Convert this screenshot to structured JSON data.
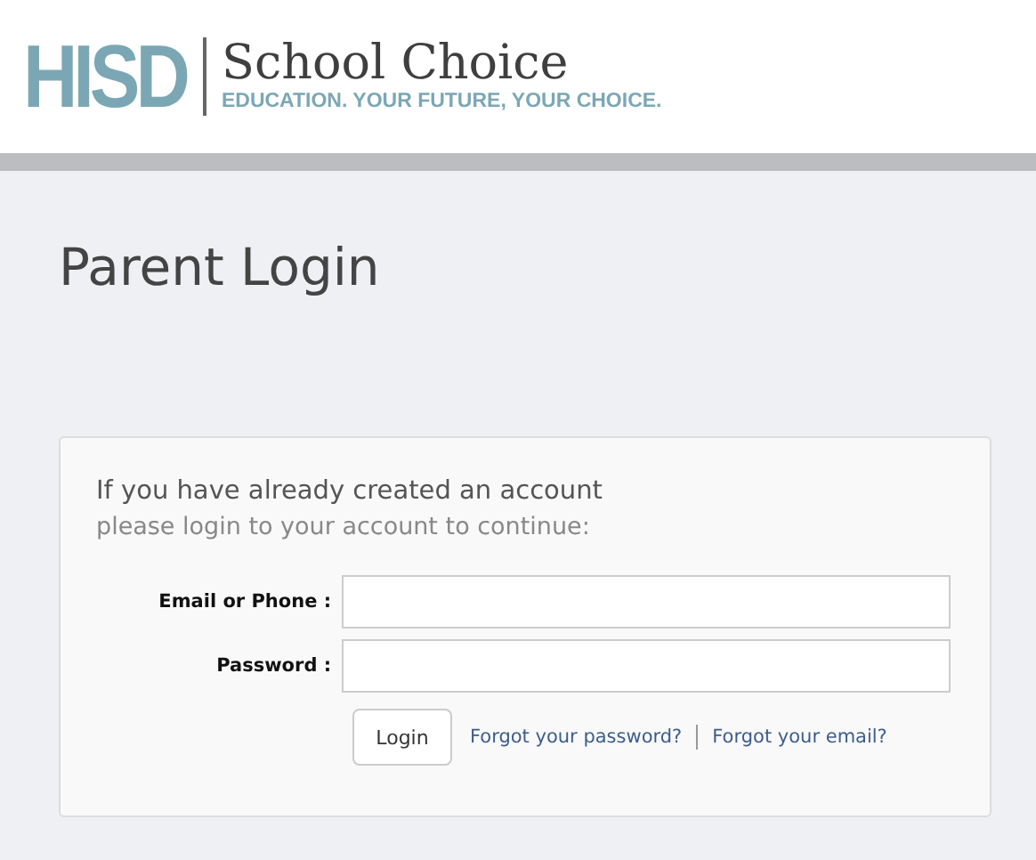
{
  "header": {
    "logo_mark": "HISD",
    "logo_title": "School Choice",
    "tagline": "EDUCATION. YOUR FUTURE, YOUR CHOICE."
  },
  "page_title": "Parent Login",
  "login_card": {
    "intro": "If you have already created an account",
    "subtext": "please login to your account to continue:",
    "fields": [
      {
        "label": "Email or Phone :"
      },
      {
        "label": "Password :"
      }
    ],
    "login_button": "Login",
    "links": [
      "Forgot your password?",
      "Forgot your email?"
    ]
  }
}
